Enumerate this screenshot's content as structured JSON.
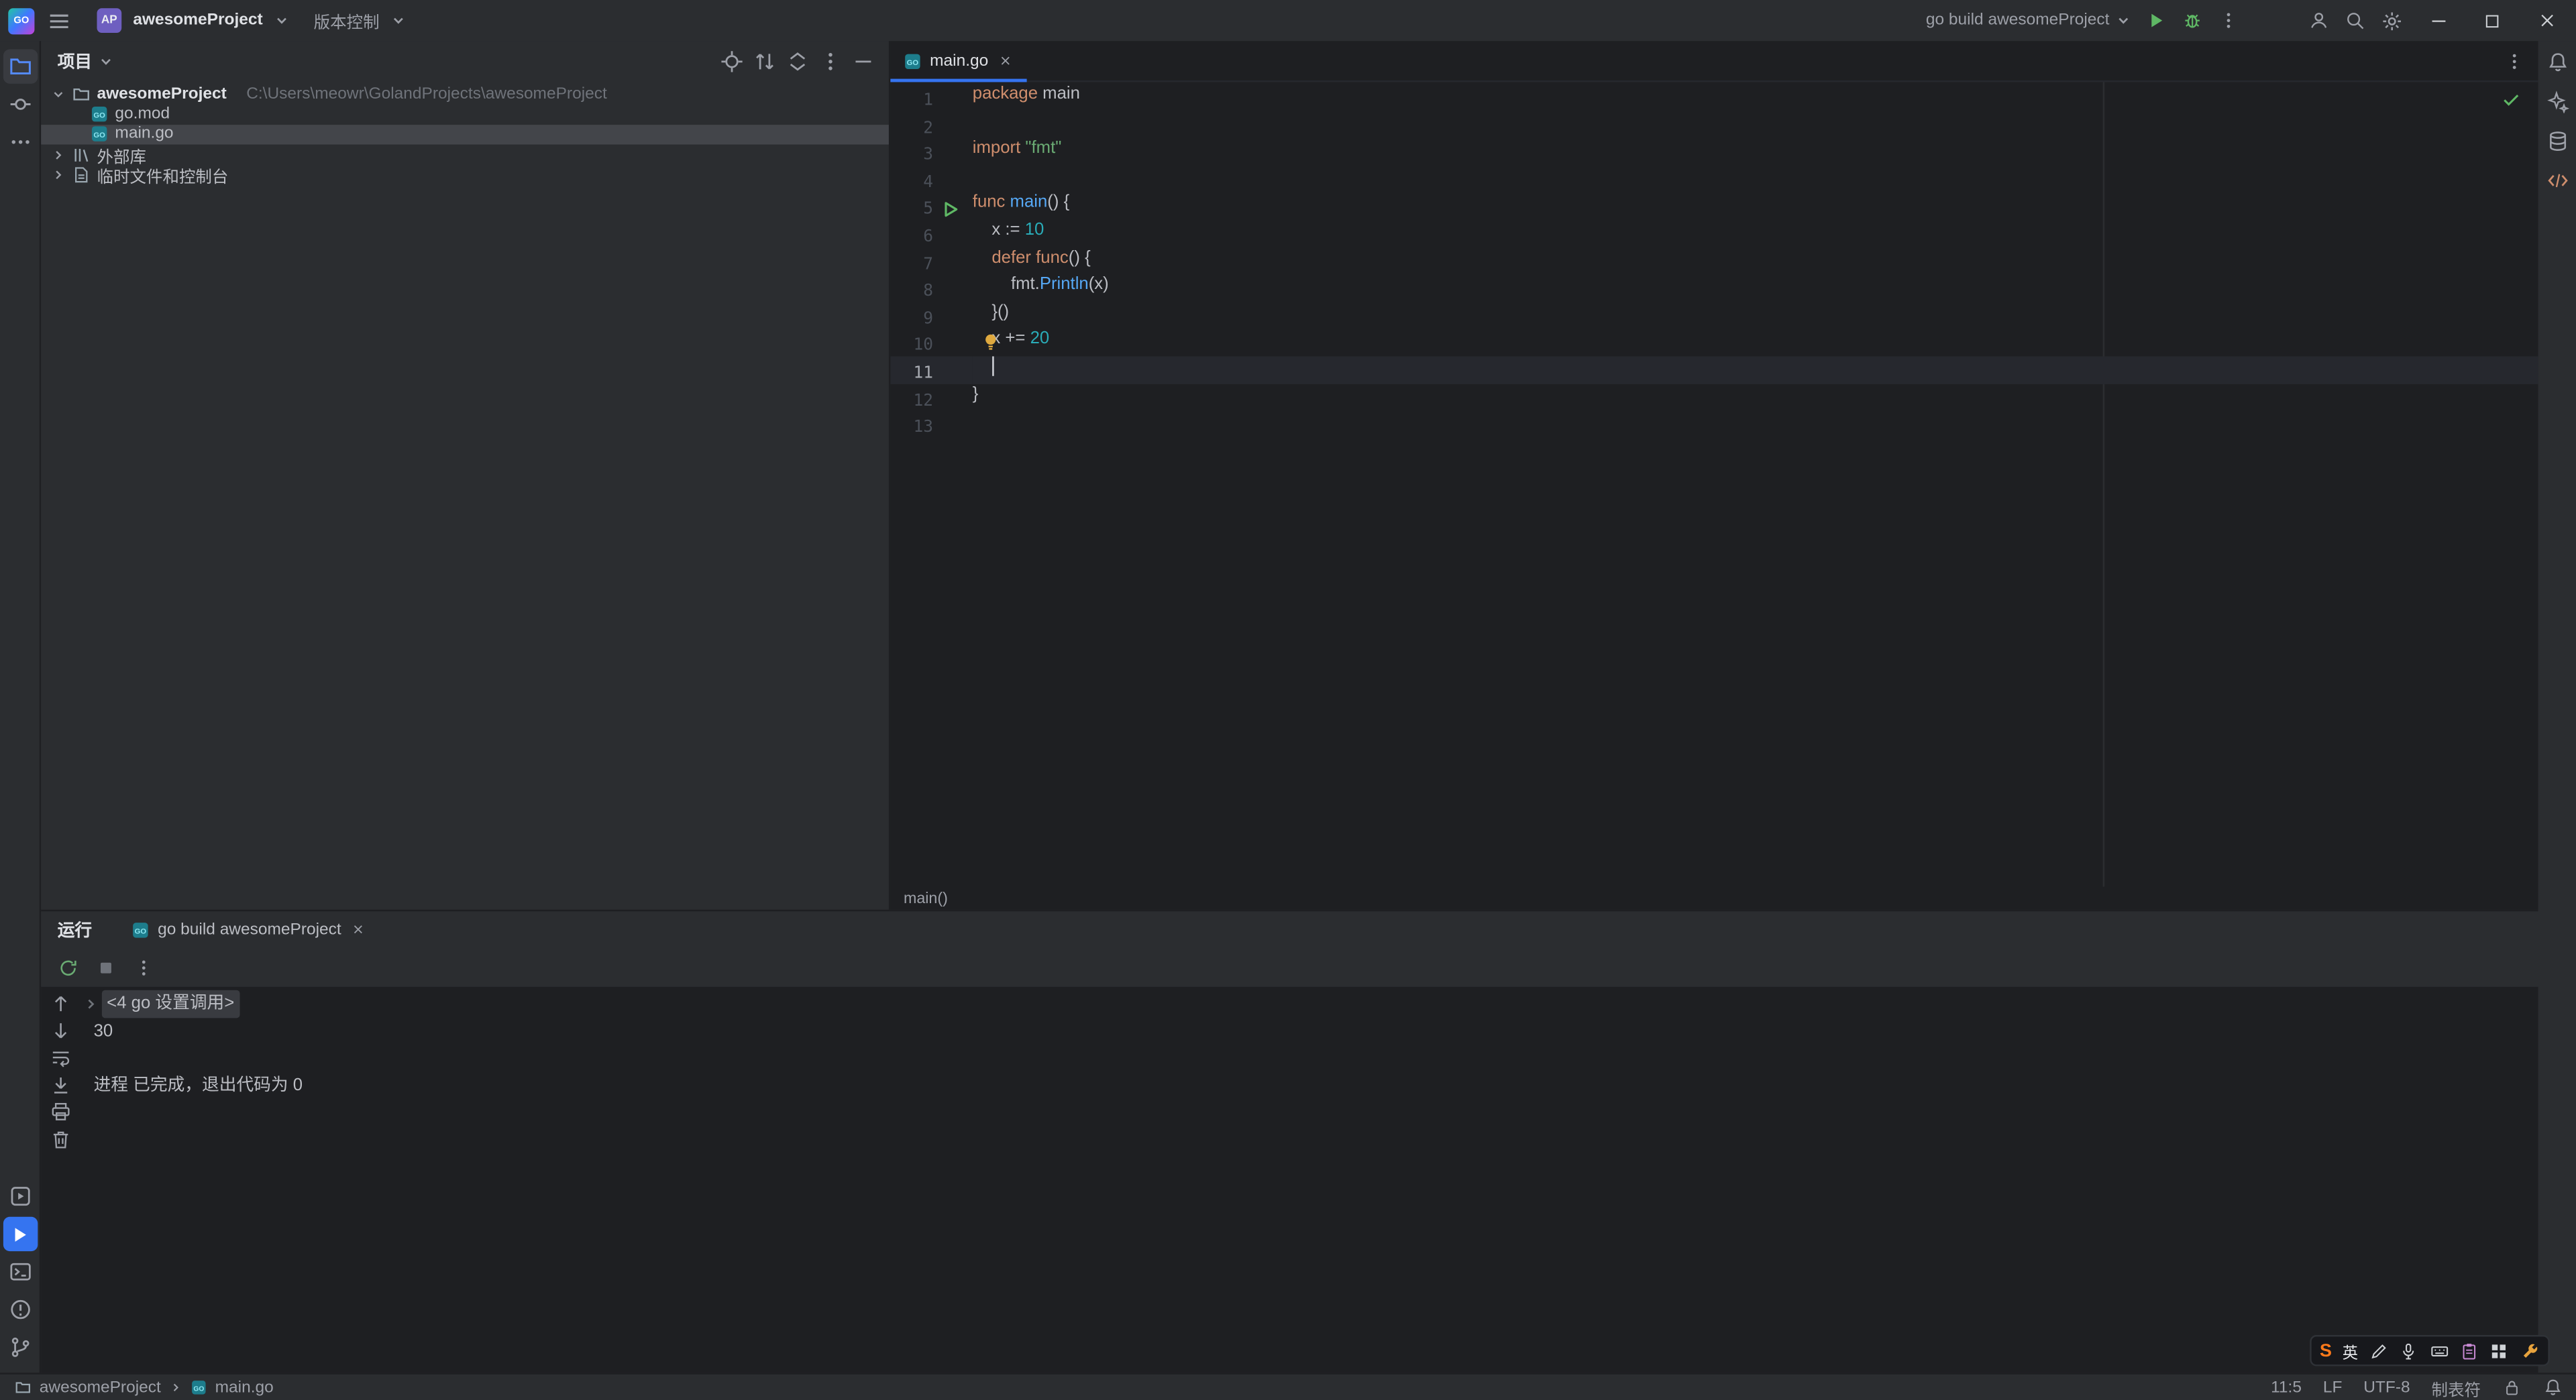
{
  "titlebar": {
    "logo_text": "GO",
    "project_badge": "AP",
    "project_name": "awesomeProject",
    "vcs_label": "版本控制",
    "run_config_label": "go build awesomeProject"
  },
  "project_panel": {
    "title": "项目",
    "tree": [
      {
        "level": 0,
        "chevron": "down",
        "icon": "folder",
        "name": "awesomeProject",
        "bold": true,
        "path": "C:\\Users\\meowr\\GolandProjects\\awesomeProject"
      },
      {
        "level": 1,
        "icon": "go-file",
        "name": "go.mod"
      },
      {
        "level": 1,
        "icon": "go-file",
        "name": "main.go",
        "selected": true
      },
      {
        "level": 0,
        "chevron": "right",
        "icon": "library",
        "name": "外部库"
      },
      {
        "level": 0,
        "chevron": "right",
        "icon": "scratch",
        "name": "临时文件和控制台"
      }
    ]
  },
  "editor": {
    "tab_label": "main.go",
    "breadcrumb": "main()",
    "palette": {
      "kw": "#cf8e6d",
      "str": "#6aab73",
      "num": "#2aacb8",
      "fn": "#56a8f5",
      "plain": "#bcbec4"
    },
    "lines": [
      {
        "n": 1,
        "tokens": [
          {
            "t": "package",
            "c": "kw"
          },
          {
            "t": " main",
            "c": "plain"
          }
        ]
      },
      {
        "n": 2,
        "tokens": []
      },
      {
        "n": 3,
        "tokens": [
          {
            "t": "import ",
            "c": "kw"
          },
          {
            "t": "\"fmt\"",
            "c": "str"
          }
        ]
      },
      {
        "n": 4,
        "tokens": []
      },
      {
        "n": 5,
        "run": true,
        "tokens": [
          {
            "t": "func ",
            "c": "kw"
          },
          {
            "t": "main",
            "c": "fn"
          },
          {
            "t": "() {",
            "c": "plain"
          }
        ]
      },
      {
        "n": 6,
        "tokens": [
          {
            "t": "    x := ",
            "c": "plain"
          },
          {
            "t": "10",
            "c": "num"
          }
        ]
      },
      {
        "n": 7,
        "tokens": [
          {
            "t": "    ",
            "c": "plain"
          },
          {
            "t": "defer",
            "c": "kw"
          },
          {
            "t": " ",
            "c": "plain"
          },
          {
            "t": "func",
            "c": "kw"
          },
          {
            "t": "() {",
            "c": "plain"
          }
        ]
      },
      {
        "n": 8,
        "tokens": [
          {
            "t": "        fmt.",
            "c": "plain"
          },
          {
            "t": "Println",
            "c": "fn"
          },
          {
            "t": "(x)",
            "c": "plain"
          }
        ]
      },
      {
        "n": 9,
        "tokens": [
          {
            "t": "    }()",
            "c": "plain"
          }
        ]
      },
      {
        "n": 10,
        "bulb": true,
        "tokens": [
          {
            "t": "    x += ",
            "c": "plain"
          },
          {
            "t": "20",
            "c": "num"
          }
        ]
      },
      {
        "n": 11,
        "current": true,
        "caret": true,
        "tokens": [
          {
            "t": "    ",
            "c": "plain"
          }
        ]
      },
      {
        "n": 12,
        "tokens": [
          {
            "t": "}",
            "c": "plain"
          }
        ]
      },
      {
        "n": 13,
        "tokens": []
      }
    ]
  },
  "run_panel": {
    "title": "运行",
    "tab_label": "go build awesomeProject",
    "console": {
      "fold_text": "<4 go 设置调用>",
      "output": "30",
      "exit_text": "进程 已完成，退出代码为 0"
    }
  },
  "statusbar": {
    "crumb_project": "awesomeProject",
    "crumb_file": "main.go",
    "caret_position": "11:5",
    "line_separator": "LF",
    "encoding": "UTF-8",
    "indent": "制表符"
  },
  "ime": {
    "logo": "S",
    "mode": "英"
  },
  "colors": {
    "accent_blue": "#3574f0",
    "run_green": "#5fb865",
    "editor_bg": "#1e1f22",
    "panel_bg": "#2b2d30",
    "selection_gray": "#43454a",
    "bulb_yellow": "#dfa93f"
  },
  "icon_names": [
    "goland-logo-icon",
    "main-menu-icon",
    "chevron-down-icon",
    "run-icon",
    "debug-bug-icon",
    "more-actions-icon",
    "user-icon",
    "search-icon",
    "settings-gear-icon",
    "minimize-icon",
    "maximize-icon",
    "close-icon",
    "locate-file-icon",
    "swap-vertical-icon",
    "collapse-all-icon",
    "panel-options-icon",
    "hide-panel-icon",
    "folder-icon",
    "go-file-icon",
    "library-icon",
    "scratch-icon",
    "project-tool-icon",
    "commit-tool-icon",
    "more-tool-windows-icon",
    "services-tool-icon",
    "run-tool-icon",
    "terminal-tool-icon",
    "problems-tool-icon",
    "version-control-tool-icon",
    "notifications-bell-icon",
    "ai-assistant-icon",
    "database-icon",
    "endpoints-code-icon",
    "run-gutter-icon",
    "intention-bulb-icon",
    "inspections-ok-icon",
    "rerun-icon",
    "stop-icon",
    "arrow-up-icon",
    "arrow-down-icon",
    "soft-wrap-icon",
    "scroll-to-end-icon",
    "print-icon",
    "clear-console-icon",
    "fold-chevron-icon",
    "readonly-lock-icon",
    "handwriting-icon",
    "mic-icon",
    "virtual-keyboard-icon",
    "clipboard-icon",
    "toolbox-grid-icon",
    "wrench-icon"
  ]
}
